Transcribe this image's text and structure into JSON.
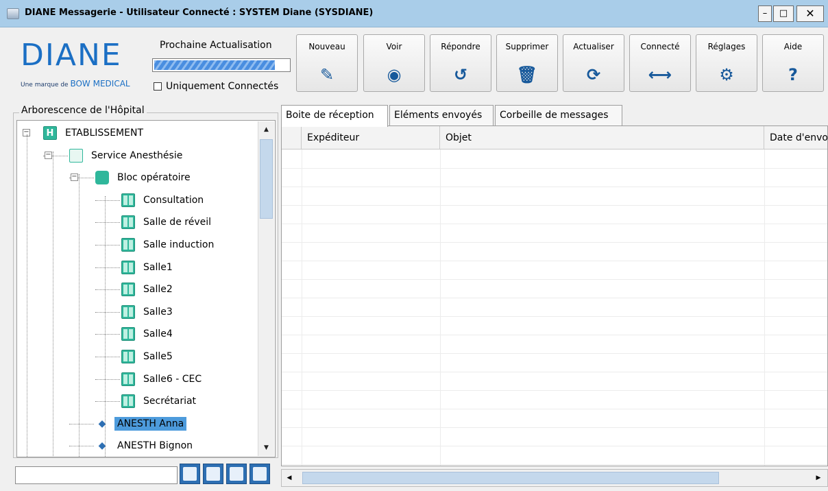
{
  "window": {
    "title": "DIANE Messagerie - Utilisateur Connecté : SYSTEM Diane (SYSDIANE)",
    "min_label": "–",
    "max_label": "□",
    "close_label": "✕"
  },
  "brand": {
    "logo": "DIANE",
    "tagline_prefix": "Une marque de",
    "tagline_brand": "BOW MEDICAL"
  },
  "refresh": {
    "label": "Prochaine Actualisation",
    "progress_fraction": 0.9
  },
  "filter": {
    "only_connected_label": "Uniquement Connectés",
    "only_connected_checked": false
  },
  "toolbar": [
    {
      "label": "Nouveau",
      "icon": "pencil-icon",
      "glyph": "✎"
    },
    {
      "label": "Voir",
      "icon": "eye-icon",
      "glyph": "◉"
    },
    {
      "label": "Répondre",
      "icon": "reply-icon",
      "glyph": "↺"
    },
    {
      "label": "Supprimer",
      "icon": "trash-icon",
      "glyph": "🗑"
    },
    {
      "label": "Actualiser",
      "icon": "refresh-icon",
      "glyph": "⟳"
    },
    {
      "label": "Connecté",
      "icon": "arrows-horizontal-icon",
      "glyph": "⟷"
    },
    {
      "label": "Réglages",
      "icon": "gears-icon",
      "glyph": "⚙"
    },
    {
      "label": "Aide",
      "icon": "help-icon",
      "glyph": "?"
    }
  ],
  "tree": {
    "title": "Arborescence de l'Hôpital",
    "items": [
      {
        "label": "ETABLISSEMENT",
        "icon": "hospital-icon"
      },
      {
        "label": "Service Anesthésie",
        "icon": "calendar-icon"
      },
      {
        "label": "Bloc opératoire",
        "icon": "operating-bed-icon"
      },
      {
        "label": "Consultation",
        "icon": "room-icon"
      },
      {
        "label": "Salle de réveil",
        "icon": "room-icon"
      },
      {
        "label": "Salle induction",
        "icon": "room-icon"
      },
      {
        "label": "Salle1",
        "icon": "room-icon"
      },
      {
        "label": "Salle2",
        "icon": "room-icon"
      },
      {
        "label": "Salle3",
        "icon": "room-icon"
      },
      {
        "label": "Salle4",
        "icon": "room-icon"
      },
      {
        "label": "Salle5",
        "icon": "room-icon"
      },
      {
        "label": "Salle6 - CEC",
        "icon": "room-icon"
      },
      {
        "label": "Secrétariat",
        "icon": "room-icon"
      },
      {
        "label": "ANESTH Anna",
        "icon": "anesthetist-icon",
        "selected": true
      },
      {
        "label": "ANESTH Bignon",
        "icon": "anesthetist-icon"
      }
    ]
  },
  "search": {
    "value": ""
  },
  "tabs": [
    {
      "label": "Boite de réception",
      "active": true
    },
    {
      "label": "Eléments envoyés",
      "active": false
    },
    {
      "label": "Corbeille de messages",
      "active": false
    }
  ],
  "grid": {
    "columns": [
      "Expéditeur",
      "Objet",
      "Date d'envoi"
    ],
    "rows": []
  }
}
